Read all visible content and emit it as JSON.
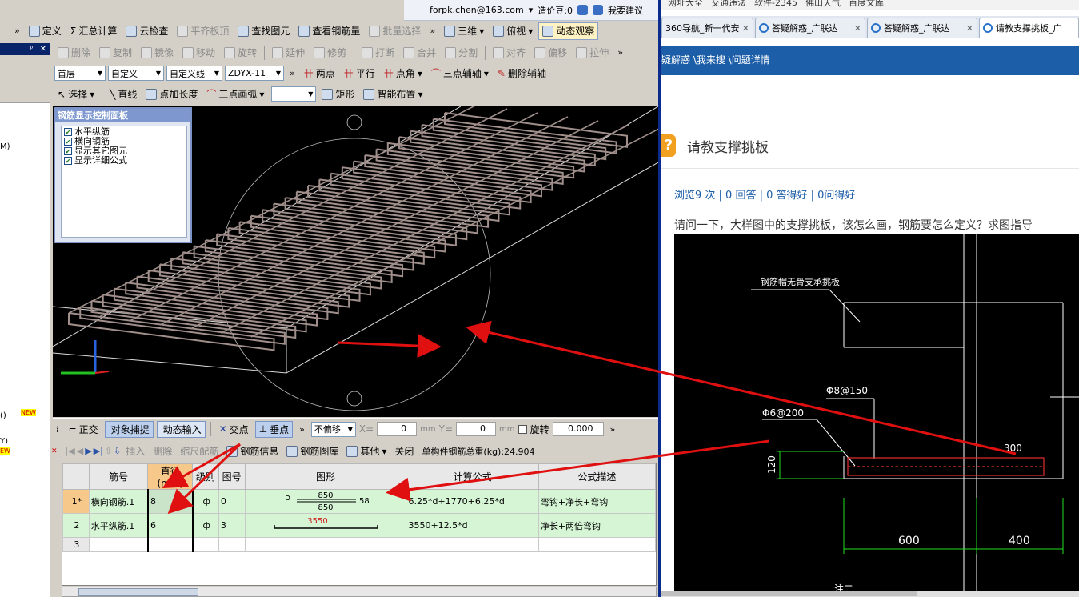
{
  "userbar": {
    "email": "forpk.chen@163.com",
    "coin_label": "造价豆:0",
    "suggest": "我要建议"
  },
  "toolbar1": {
    "define": "定义",
    "calc": "汇总计算",
    "cloud": "云检查",
    "flush": "平齐板顶",
    "find": "查找图元",
    "view_rebar": "查看钢筋量",
    "batch": "批量选择",
    "three_d": "三维",
    "top_view": "俯视",
    "dynamic": "动态观察"
  },
  "toolbar2": {
    "delete": "删除",
    "copy": "复制",
    "mirror": "镜像",
    "move": "移动",
    "rotate": "旋转",
    "extend": "延伸",
    "trim": "修剪",
    "break": "打断",
    "merge": "合并",
    "split": "分割",
    "align": "对齐",
    "offset": "偏移",
    "stretch": "拉伸"
  },
  "toolbar3": {
    "floor": "首层",
    "custom": "自定义",
    "custom_line": "自定义线",
    "code": "ZDYX-11",
    "two_point": "两点",
    "parallel": "平行",
    "point_angle": "点角",
    "three_axis": "三点辅轴",
    "del_axis": "删除辅轴"
  },
  "toolbar4": {
    "select": "选择",
    "line": "直线",
    "add_length": "点加长度",
    "arc": "三点画弧",
    "rect": "矩形",
    "smart": "智能布置"
  },
  "control_panel": {
    "title": "钢筋显示控制面板",
    "options": [
      "水平纵筋",
      "横向钢筋",
      "显示其它图元",
      "显示详细公式"
    ]
  },
  "status": {
    "ortho": "正交",
    "snap": "对象捕捉",
    "dyn_input": "动态输入",
    "intersect": "交点",
    "perp": "垂点",
    "offset_mode": "不偏移",
    "x_label": "X=",
    "x_val": "0",
    "y_label": "Y=",
    "y_val": "0",
    "unit": "mm",
    "rotate": "旋转",
    "rot_val": "0.000"
  },
  "grid_toolbar": {
    "insert": "插入",
    "delete": "删除",
    "scale": "缩尺配筋",
    "rebar_info": "钢筋信息",
    "rebar_lib": "钢筋图库",
    "other": "其他",
    "close": "关闭",
    "total": "单构件钢筋总重(kg):24.904"
  },
  "table": {
    "headers": [
      "",
      "筋号",
      "直径(mm)",
      "级别",
      "图号",
      "图形",
      "计算公式",
      "公式描述"
    ],
    "rows": [
      {
        "no": "1*",
        "name": "横向钢筋.1",
        "dia": "8",
        "grade": "ф",
        "fig": "0",
        "shape_top": "850",
        "shape_bot": "850",
        "shape_side": "58",
        "shape_left": "ↄ",
        "formula": "6.25*d+1770+6.25*d",
        "desc": "弯钩+净长+弯钩"
      },
      {
        "no": "2",
        "name": "水平纵筋.1",
        "dia": "6",
        "grade": "ф",
        "fig": "3",
        "shape_top": "3550",
        "formula": "3550+12.5*d",
        "desc": "净长+两倍弯钩"
      },
      {
        "no": "3",
        "name": "",
        "dia": "",
        "grade": "",
        "fig": "",
        "formula": "",
        "desc": ""
      }
    ]
  },
  "left_panel": {
    "t1": "M)",
    "t2": "()",
    "t3": "NEW",
    "t4": "Y)",
    "t5": "EW"
  },
  "browser": {
    "bookmarks": [
      "网址大全",
      "交通违法",
      "软件-2345",
      "佛山天气",
      "百度文库"
    ],
    "tabs": [
      "360导航_新一代安",
      "答疑解惑_广联达",
      "答疑解惑_广联达",
      "请教支撑挑板_广"
    ],
    "breadcrumb": "疑解惑 \\我来搜 \\问题详情",
    "q_badge": "?",
    "q_title": "请教支撑挑板",
    "stats": "浏览9 次 | 0 回答 | 0 答得好 | 0问得好",
    "question": "请问一下，大样图中的支撑挑板，该怎么画，钢筋要怎么定义？求图指导",
    "cad": {
      "label1": "钢筋帽无骨支承挑板",
      "label2": "Φ8@150",
      "label3": "Φ6@200",
      "dim300": "300",
      "dim120": "120",
      "dim600": "600",
      "dim400": "400",
      "bottom_text": "注二"
    }
  },
  "colors": {
    "viewport_bg": "#000000",
    "rebar": "#a08f8a",
    "arrow": "#e01010",
    "browser_blue": "#1d5ea8",
    "row_green": "#d5f5d5",
    "header_orange": "#f6c88a"
  }
}
